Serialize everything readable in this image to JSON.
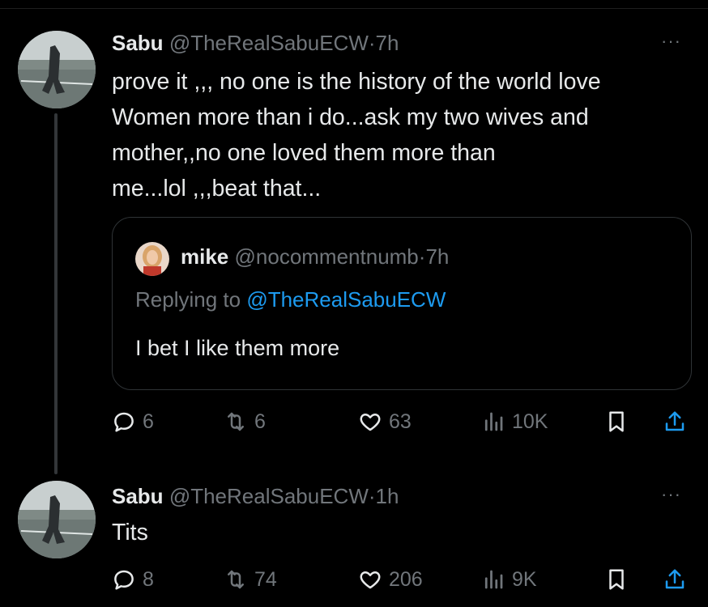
{
  "tweets": [
    {
      "name": "Sabu",
      "handle": "@TheRealSabuECW",
      "separator": "·",
      "time": "7h",
      "more": "···",
      "text_lines": [
        "prove it ,,, no one is the history of the world love",
        "Women more than  i do...ask my two wives and",
        "mother,,no one loved them more than",
        "me...lol ,,,beat that..."
      ],
      "quote": {
        "name": "mike",
        "handle": "@nocommentnumb",
        "separator": "·",
        "time": "7h",
        "replying_prefix": "Replying to",
        "replying_to": "@TheRealSabuECW",
        "text": "I bet I like them more"
      },
      "actions": {
        "replies": "6",
        "retweets": "6",
        "likes": "63",
        "views": "10K"
      }
    },
    {
      "name": "Sabu",
      "handle": "@TheRealSabuECW",
      "separator": "·",
      "time": "1h",
      "more": "···",
      "text_lines": [
        "Tits"
      ],
      "actions": {
        "replies": "8",
        "retweets": "74",
        "likes": "206",
        "views": "9K"
      }
    }
  ],
  "icons": {
    "reply": "reply-icon",
    "retweet": "retweet-icon",
    "like": "heart-icon",
    "views": "views-icon",
    "bookmark": "bookmark-icon",
    "share": "share-icon"
  },
  "colors": {
    "background": "#000000",
    "text": "#e7e9ea",
    "muted": "#71767b",
    "link": "#1d9bf0",
    "border": "#2f3336"
  }
}
